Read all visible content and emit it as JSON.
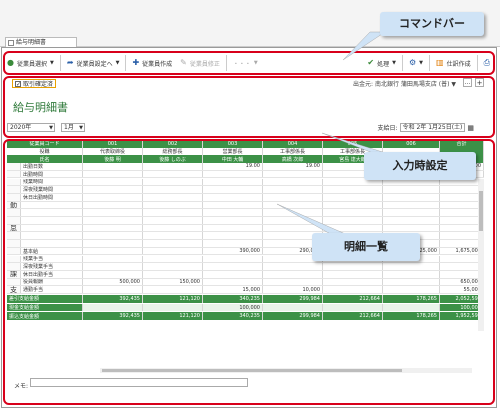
{
  "tab": {
    "title": "給与明細書"
  },
  "toolbar": {
    "select_employee": "従業員選択",
    "employee_settings": "従業員設定へ",
    "create_employee": "従業員作成",
    "edit_employee": "従業員修正",
    "more": "・・・",
    "process": "処理",
    "settings_icon_label": "",
    "journal": "仕訳作成"
  },
  "callouts": {
    "command_bar": "コマンドバー",
    "input_settings": "入力時設定",
    "detail_list": "明細一覧"
  },
  "input_settings": {
    "checkbox_label": "取引確定済",
    "source_label": "出金元:",
    "source_value": "南北銀行 蒲田馬場支店 (普)",
    "page_title": "給与明細書",
    "year": "2020年",
    "month": "1月",
    "payday_label": "支給日:",
    "payday_era": "令和",
    "payday_value": "2年 1月25日(土)"
  },
  "grid": {
    "corner_headers": [
      "従業員コード",
      "役職",
      "氏名"
    ],
    "columns": [
      {
        "code": "001",
        "role": "代表取締役",
        "name": "後藤 明"
      },
      {
        "code": "002",
        "role": "総務部長",
        "name": "後藤 しのぶ"
      },
      {
        "code": "003",
        "role": "営業部長",
        "name": "中田 大輔"
      },
      {
        "code": "004",
        "role": "工事部係長",
        "name": "高橋 次郎"
      },
      {
        "code": "005",
        "role": "工事部係長",
        "name": "宮島 達大郎"
      },
      {
        "code": "006",
        "role": "",
        "name": ""
      }
    ],
    "total_header": "合計",
    "section1": "勤",
    "section2": "怠",
    "section3": "課",
    "section4": "支",
    "rows": [
      {
        "label": "出勤日数",
        "vals": [
          "",
          "",
          "19.00",
          "19.00",
          "19.00",
          ""
        ],
        "total": "114.00"
      },
      {
        "label": "出勤時間",
        "vals": [
          "",
          "",
          "",
          "",
          "",
          ""
        ],
        "total": ""
      },
      {
        "label": "残業時間",
        "vals": [
          "",
          "",
          "",
          "",
          "",
          ""
        ],
        "total": ""
      },
      {
        "label": "深夜残業時間",
        "vals": [
          "",
          "",
          "",
          "",
          "",
          ""
        ],
        "total": ""
      },
      {
        "label": "休日出勤時間",
        "vals": [
          "",
          "",
          "",
          "",
          "",
          ""
        ],
        "total": ""
      },
      {
        "label": "",
        "vals": [
          "",
          "",
          "",
          "",
          "",
          ""
        ],
        "total": ""
      },
      {
        "label": "",
        "vals": [
          "",
          "",
          "",
          "",
          "",
          ""
        ],
        "total": ""
      },
      {
        "label": "",
        "vals": [
          "",
          "",
          "",
          "",
          "",
          ""
        ],
        "total": ""
      },
      {
        "label": "",
        "vals": [
          "",
          "",
          "",
          "",
          "",
          ""
        ],
        "total": ""
      },
      {
        "label": "",
        "vals": [
          "",
          "",
          "",
          "",
          "",
          ""
        ],
        "total": ""
      },
      {
        "label": "",
        "vals": [
          "",
          "",
          "",
          "",
          "",
          ""
        ],
        "total": ""
      },
      {
        "label": "基本給",
        "vals": [
          "",
          "",
          "390,000",
          "290,000",
          "240,000",
          "225,000"
        ],
        "total": "1,675,000"
      },
      {
        "label": "残業手当",
        "vals": [
          "",
          "",
          "",
          "",
          "",
          ""
        ],
        "total": ""
      },
      {
        "label": "深夜残業手当",
        "vals": [
          "",
          "",
          "",
          "",
          "",
          ""
        ],
        "total": ""
      },
      {
        "label": "休日出勤手当",
        "vals": [
          "",
          "",
          "",
          "",
          "",
          ""
        ],
        "total": ""
      },
      {
        "label": "役員報酬",
        "vals": [
          "500,000",
          "150,000",
          "",
          "",
          "",
          ""
        ],
        "total": "650,000"
      },
      {
        "label": "通勤手当",
        "vals": [
          "",
          "",
          "15,000",
          "10,000",
          "",
          ""
        ],
        "total": "55,000"
      }
    ],
    "footer": [
      {
        "label": "差引支給金額",
        "vals": [
          "392,435",
          "121,120",
          "340,235",
          "299,984",
          "212,664",
          "178,265"
        ],
        "total": "2,052,594"
      },
      {
        "label": "現金支給金額",
        "vals": [
          "",
          "",
          "100,000",
          "",
          "",
          ""
        ],
        "total": "100,000"
      },
      {
        "label": "振込支給金額",
        "vals": [
          "392,435",
          "121,120",
          "340,235",
          "299,984",
          "212,664",
          "178,265"
        ],
        "total": "1,952,594"
      }
    ]
  },
  "memo_label": "メモ:",
  "colors": {
    "header_green": "#3c9147",
    "footer_green": "#3c9147",
    "highlight_red": "#d8001b",
    "callout_blue": "#cfe3f6"
  }
}
